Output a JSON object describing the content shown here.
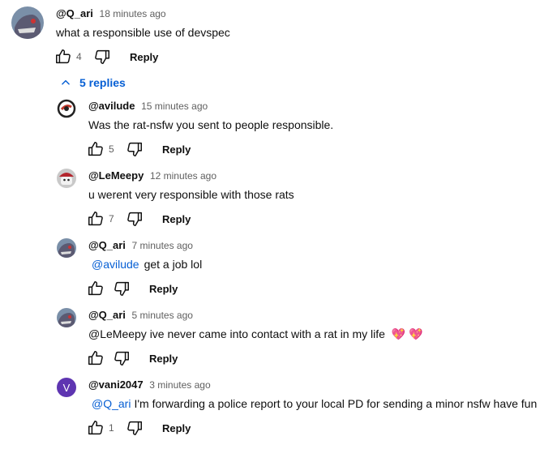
{
  "top_comment": {
    "author": "@Q_ari",
    "time": "18 minutes ago",
    "text": "what a responsible use of devspec",
    "likes": "4",
    "reply_label": "Reply"
  },
  "replies_toggle": {
    "label": "5 replies"
  },
  "replies": [
    {
      "author": "@avilude",
      "time": "15 minutes ago",
      "mention": "",
      "text": "Was the rat-nsfw you sent to people responsible.",
      "likes": "5",
      "reply_label": "Reply"
    },
    {
      "author": "@LeMeepy",
      "time": "12 minutes ago",
      "mention": "",
      "text": "u werent very responsible with those rats",
      "likes": "7",
      "reply_label": "Reply"
    },
    {
      "author": "@Q_ari",
      "time": "7 minutes ago",
      "mention": "@avilude",
      "text": "get a job lol",
      "likes": "",
      "reply_label": "Reply"
    },
    {
      "author": "@Q_ari",
      "time": "5 minutes ago",
      "mention": "",
      "text": "@LeMeepy ive never came into contact with a rat in my life",
      "emoji": "💖 💖",
      "likes": "",
      "reply_label": "Reply"
    },
    {
      "author": "@vani2047",
      "time": "3 minutes ago",
      "mention": "@Q_ari",
      "text": "I'm forwarding a police report to your local PD for sending a minor nsfw have fun",
      "likes": "1",
      "reply_label": "Reply",
      "avatar_letter": "V"
    }
  ],
  "colors": {
    "link_blue": "#065fd4",
    "meta_gray": "#606060",
    "vani_avatar": "#5e35b1"
  }
}
